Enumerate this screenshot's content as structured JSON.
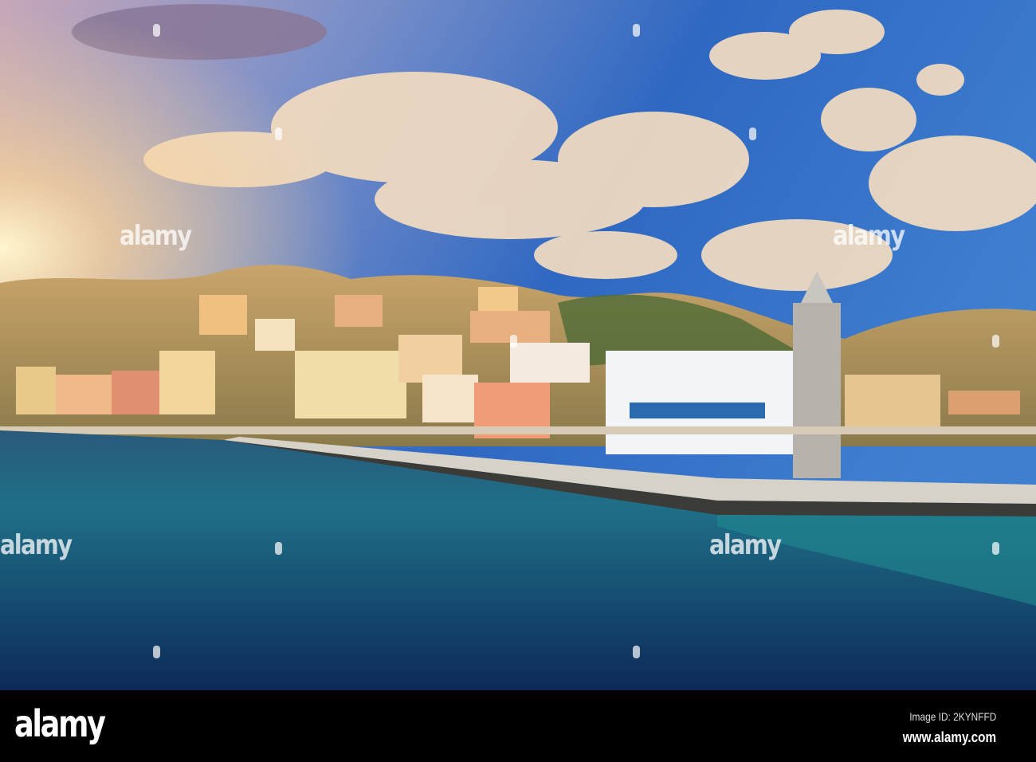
{
  "photo": {
    "subject": "Harbour of a Greek island town with colorful neoclassical houses, white building and stone clock tower",
    "watermark_text": "alamy"
  },
  "footer": {
    "logo": "alamy",
    "image_id": "Image ID: 2KYNFFD",
    "url": "www.alamy.com"
  }
}
